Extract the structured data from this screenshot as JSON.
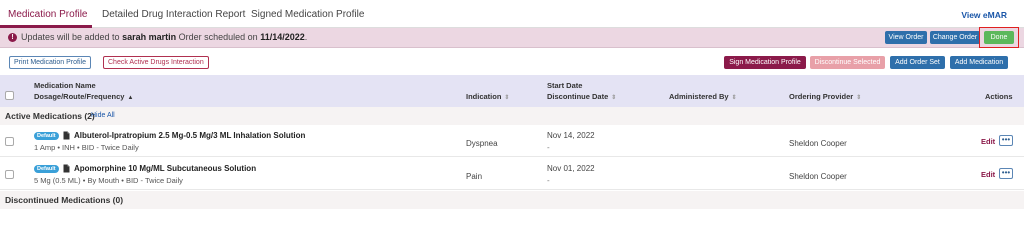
{
  "tabs": {
    "items": [
      {
        "label": "Medication Profile"
      },
      {
        "label": "Detailed Drug Interaction Report"
      },
      {
        "label": "Signed Medication Profile"
      }
    ],
    "view_emar": "View eMAR"
  },
  "banner": {
    "prefix": "Updates will be added to",
    "patient": "sarah martin",
    "middle": "Order scheduled on",
    "date": "11/14/2022",
    "suffix": ".",
    "view_order": "View Order",
    "change_order": "Change Order",
    "done": "Done"
  },
  "toolbar": {
    "print": "Print Medication Profile",
    "check_interaction": "Check Active Drugs Interaction",
    "sign": "Sign Medication Profile",
    "discontinue": "Discontinue Selected",
    "add_order_set": "Add Order Set",
    "add_medication": "Add Medication"
  },
  "table": {
    "headers": {
      "name_line1": "Medication Name",
      "name_line2": "Dosage/Route/Frequency",
      "indication": "Indication",
      "start_date": "Start Date",
      "discontinue_date": "Discontinue Date",
      "administered_by": "Administered By",
      "ordering_provider": "Ordering Provider",
      "actions": "Actions"
    },
    "sort_glyph": "⇕",
    "sort_up_glyph": "▲",
    "active_section": {
      "label": "Active Medications (2)",
      "hide_all": "Hide All"
    },
    "discontinued_section": {
      "label": "Discontinued Medications (0)"
    },
    "rows": [
      {
        "badge": "Default",
        "name": "Albuterol-Ipratropium 2.5 Mg-0.5 Mg/3 ML Inhalation Solution",
        "detail": "1 Amp • INH • BID - Twice Daily",
        "indication": "Dyspnea",
        "start_date": "Nov 14, 2022",
        "discontinue_date": "-",
        "ordering_provider": "Sheldon Cooper",
        "edit": "Edit",
        "more": "•••"
      },
      {
        "badge": "Default",
        "name": "Apomorphine 10 Mg/ML Subcutaneous Solution",
        "detail": "5 Mg (0.5 ML) • By Mouth • BID - Twice Daily",
        "indication": "Pain",
        "start_date": "Nov 01, 2022",
        "discontinue_date": "-",
        "ordering_provider": "Sheldon Cooper",
        "edit": "Edit",
        "more": "•••"
      }
    ]
  },
  "colors": {
    "brand": "#8b1a4a",
    "primary_button": "#2e6fab",
    "done_button": "#5cb85c",
    "banner_bg": "#ecd7e2",
    "header_bg": "#e4e3f4",
    "badge": "#3aa0d8"
  },
  "icons": {
    "info": "info-circle-icon",
    "document": "document-icon",
    "more": "more-icon"
  }
}
